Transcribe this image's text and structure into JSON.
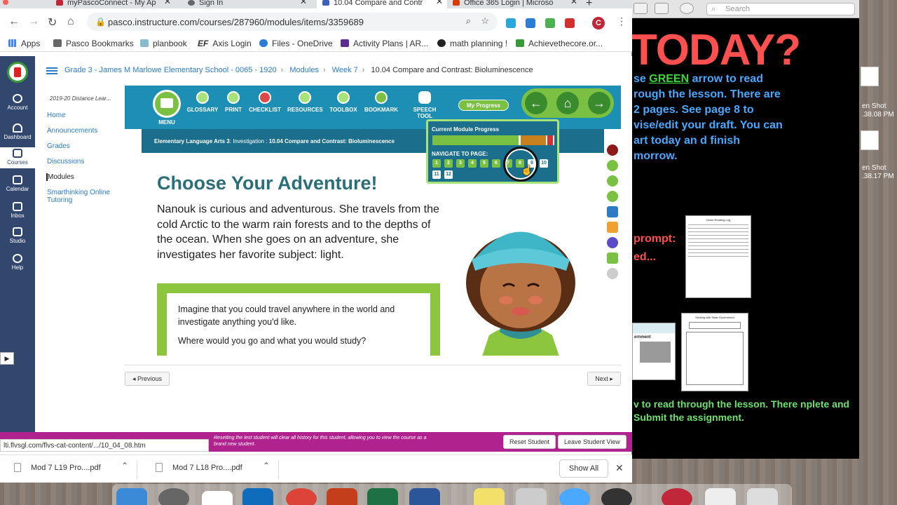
{
  "browser": {
    "tabs": [
      {
        "title": "myPascoConnect - My Ap",
        "active": false
      },
      {
        "title": "Sign In",
        "active": false
      },
      {
        "title": "10.04 Compare and Contr",
        "active": true
      },
      {
        "title": "Office 365 Login | Microso",
        "active": false
      }
    ],
    "new_tab": "+",
    "url": "pasco.instructure.com/courses/287960/modules/items/3359689",
    "avatar_letter": "C",
    "bookmarks": [
      {
        "label": "Apps",
        "icon": "apps-grid-icon"
      },
      {
        "label": "Pasco Bookmarks",
        "icon": "folder-icon"
      },
      {
        "label": "planbook",
        "icon": "planbook-icon"
      },
      {
        "label": "Axis Login",
        "icon": "ef-icon",
        "prefix": "EF"
      },
      {
        "label": "Files - OneDrive",
        "icon": "onedrive-icon"
      },
      {
        "label": "Activity Plans | AR...",
        "icon": "activity-icon"
      },
      {
        "label": "math planning !",
        "icon": "github-icon"
      },
      {
        "label": "Achievethecore.or...",
        "icon": "achieve-icon"
      }
    ]
  },
  "canvas": {
    "global_nav": [
      "Account",
      "Dashboard",
      "Courses",
      "Calendar",
      "Inbox",
      "Studio",
      "Help"
    ],
    "breadcrumb": [
      "Grade 3 - James M Marlowe Elementary School - 0065 - 1920",
      "Modules",
      "Week 7",
      "10.04 Compare and Contrast: Bioluminescence"
    ],
    "course_nav_term": "2019-20 Distance Lear...",
    "course_nav": [
      "Home",
      "Announcements",
      "Grades",
      "Discussions",
      "Modules",
      "Smarthinking Online Tutoring"
    ],
    "previous": "◂ Previous",
    "next": "Next ▸",
    "status_url": "lti.flvsgl.com/flvs-cat-content/.../10_04_08.htm",
    "student_bar_msg": "Resetting the test student will clear all history for this student, allowing you to view the course as a brand new student.",
    "reset_student": "Reset Student",
    "leave_student_view": "Leave Student View"
  },
  "lesson": {
    "menu_label": "MENU",
    "toolbar": [
      "GLOSSARY",
      "PRINT",
      "CHECKLIST",
      "RESOURCES",
      "TOOLBOX",
      "BOOKMARK",
      "SPEECH TOOL"
    ],
    "my_progress": "My Progress",
    "header_course": "Elementary Language Arts 3",
    "header_rest": ": Investigation : ",
    "header_lesson": "10.04 Compare and Contrast: Bioluminescence",
    "progress_label": "Current Module Progress",
    "navigate_label": "NAVIGATE TO PAGE:",
    "pages": [
      "1",
      "2",
      "3",
      "4",
      "5",
      "6",
      "7",
      "8",
      "9",
      "10",
      "11",
      "12"
    ],
    "current_page": 8,
    "module_progress": 0.72,
    "title": "Choose Your Adventure!",
    "paragraph": "Nanouk is curious and adventurous. She travels from the cold Arctic to the warm rain forests and to the depths of the ocean. When she goes on an adventure, she investigates her favorite subject: light.",
    "prompt_1": "Imagine that you could travel anywhere in the world and investigate anything you'd like.",
    "prompt_2": "Where would you go and what you would study?"
  },
  "downloads": {
    "items": [
      "Mod 7 L19 Pro....pdf",
      "Mod 7 L18 Pro....pdf"
    ],
    "show_all": "Show All"
  },
  "right_window": {
    "search_placeholder": "Search",
    "big_title": "TODAY?",
    "line_pre": "se ",
    "green_word": "GREEN",
    "line_post": " arrow to read",
    "lines": [
      "rough the lesson. There are",
      "2 pages. See page 8 to",
      "vise/edit your draft. You can",
      "art today an d finish",
      "morrow."
    ],
    "prompt_label": "prompt:",
    "red_line2": "ed...",
    "bottom_text": "v to read through the lesson. There nplete and Submit the assignment.",
    "doc_title": "Home Reading Log",
    "doc2_title": "Sticking with State Government",
    "ernment": "ernment"
  },
  "desktop_files": [
    "en Shot",
    ".38.08 PM",
    "en Shot",
    ".38.17 PM"
  ]
}
